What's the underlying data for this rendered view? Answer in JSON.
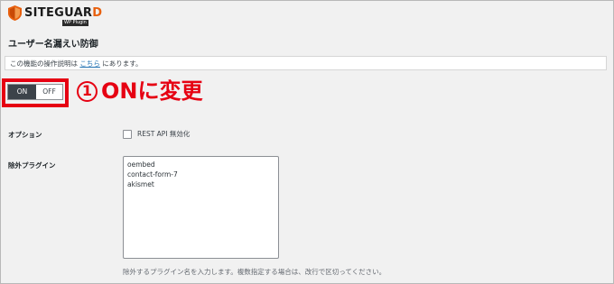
{
  "brand": {
    "name_main": "SITEGUAR",
    "name_accent": "D",
    "sub": "WP Plugin"
  },
  "page": {
    "title": "ユーザー名漏えい防御"
  },
  "notice": {
    "text_before": "この機能の操作説明は",
    "link": "こちら",
    "text_after": "にあります。"
  },
  "toggle": {
    "on_label": "ON",
    "off_label": "OFF",
    "state": "ON"
  },
  "annotation": {
    "number": "1",
    "text": "ONに変更",
    "color": "#e60012"
  },
  "options": {
    "label": "オプション",
    "checkbox_label": "REST API 無効化",
    "checked": false
  },
  "exclude": {
    "label": "除外プラグイン",
    "values": [
      "oembed",
      "contact-form-7",
      "akismet"
    ],
    "help": "除外するプラグイン名を入力します。複数指定する場合は、改行で区切ってください。"
  }
}
